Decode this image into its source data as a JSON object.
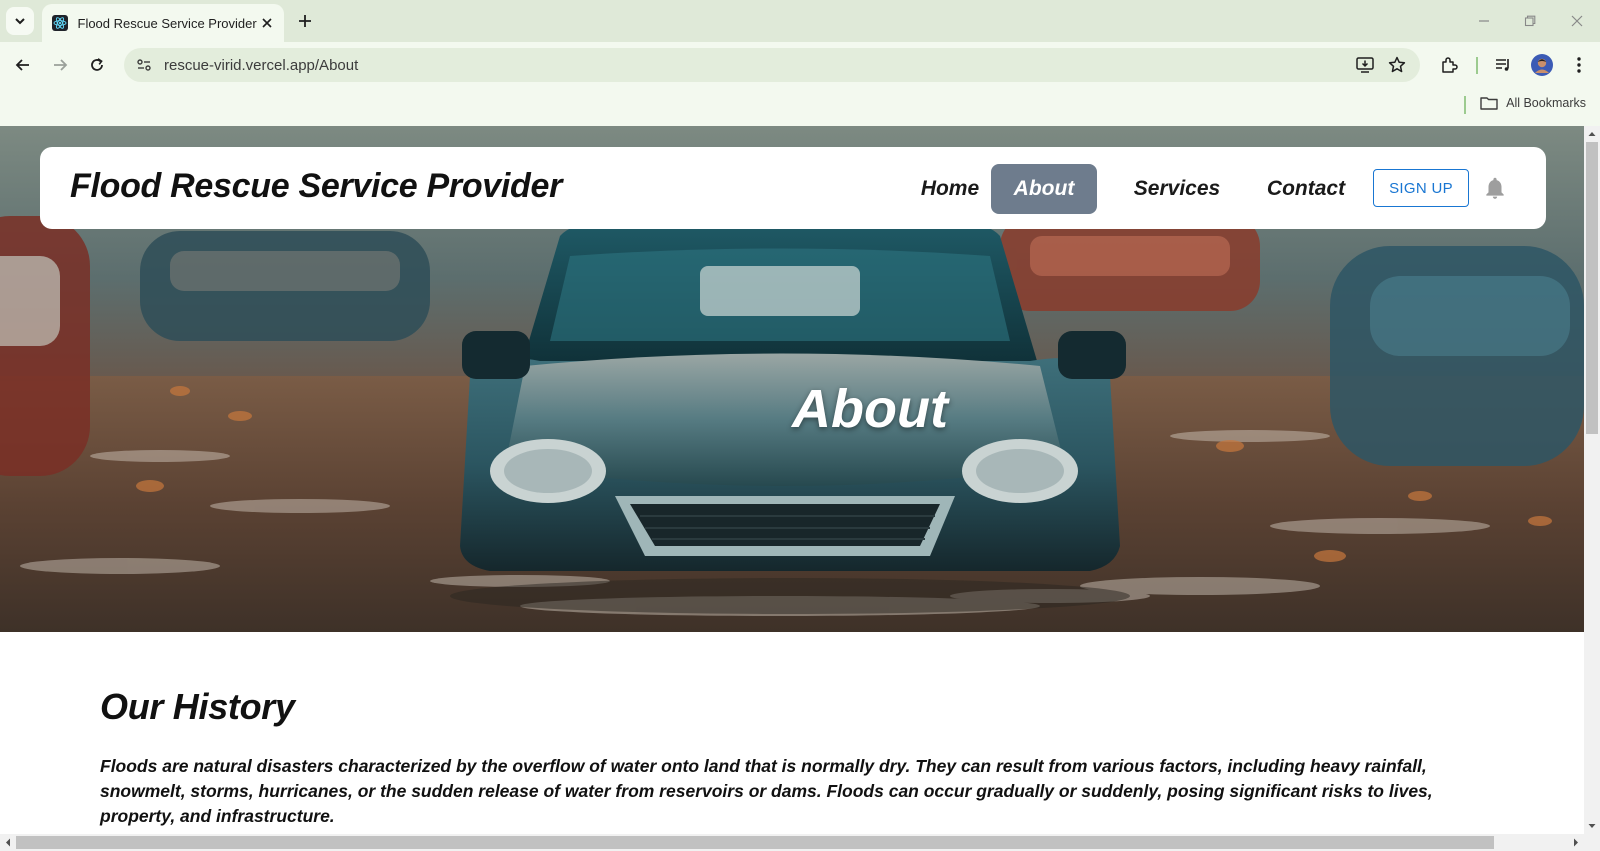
{
  "browser": {
    "tab_title": "Flood Rescue Service Provider",
    "url": "rescue-virid.vercel.app/About",
    "bookmarks_label": "All Bookmarks"
  },
  "colors": {
    "tabbar_bg": "#dfe9d8",
    "toolbar_bg": "#f3f9ef",
    "nav_active_bg": "#6e7c8d",
    "signup_blue": "#1976d2"
  },
  "nav": {
    "brand": "Flood Rescue Service Provider",
    "links": [
      {
        "label": "Home",
        "active": false
      },
      {
        "label": "About",
        "active": true
      },
      {
        "label": "Services",
        "active": false
      },
      {
        "label": "Contact",
        "active": false
      }
    ],
    "signup_label": "SIGN UP",
    "bell_icon": "bell-icon"
  },
  "hero": {
    "title": "About"
  },
  "history": {
    "heading": "Our History",
    "paragraph": "Floods are natural disasters characterized by the overflow of water onto land that is normally dry. They can result from various factors, including heavy rainfall, snowmelt, storms, hurricanes, or the sudden release of water from reservoirs or dams. Floods can occur gradually or suddenly, posing significant risks to lives, property, and infrastructure."
  }
}
